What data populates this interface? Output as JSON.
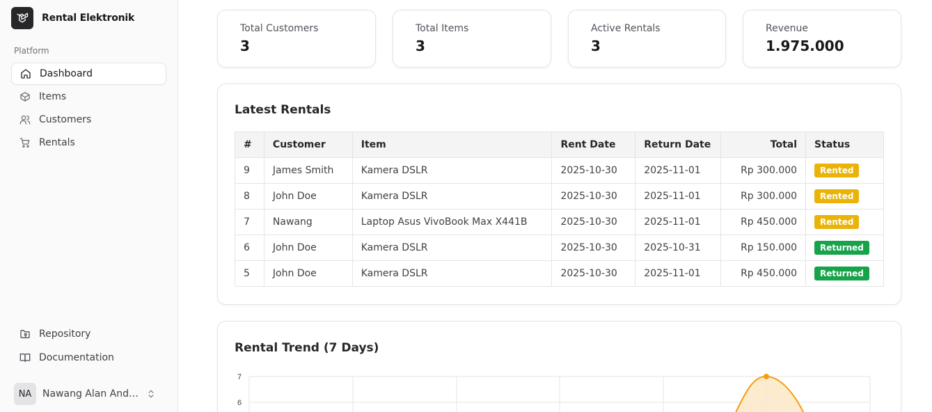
{
  "app": {
    "name": "Rental Elektronik"
  },
  "sidebar": {
    "group_label": "Platform",
    "items": [
      {
        "label": "Dashboard",
        "icon": "home-icon",
        "active": true
      },
      {
        "label": "Items",
        "icon": "box-icon",
        "active": false
      },
      {
        "label": "Customers",
        "icon": "users-icon",
        "active": false
      },
      {
        "label": "Rentals",
        "icon": "cart-icon",
        "active": false
      }
    ],
    "bottom_items": [
      {
        "label": "Repository",
        "icon": "folder-git-icon"
      },
      {
        "label": "Documentation",
        "icon": "book-open-icon"
      }
    ],
    "user": {
      "initials": "NA",
      "name": "Nawang Alan Andri..."
    }
  },
  "stats": [
    {
      "label": "Total Customers",
      "value": "3"
    },
    {
      "label": "Total Items",
      "value": "3"
    },
    {
      "label": "Active Rentals",
      "value": "3"
    },
    {
      "label": "Revenue",
      "value": "1.975.000"
    }
  ],
  "latest_rentals": {
    "title": "Latest Rentals",
    "columns": [
      "#",
      "Customer",
      "Item",
      "Rent Date",
      "Return Date",
      "Total",
      "Status"
    ],
    "rows": [
      {
        "id": "9",
        "customer": "James Smith",
        "item": "Kamera DSLR",
        "rent_date": "2025-10-30",
        "return_date": "2025-11-01",
        "total": "Rp 300.000",
        "status": "Rented"
      },
      {
        "id": "8",
        "customer": "John Doe",
        "item": "Kamera DSLR",
        "rent_date": "2025-10-30",
        "return_date": "2025-11-01",
        "total": "Rp 300.000",
        "status": "Rented"
      },
      {
        "id": "7",
        "customer": "Nawang",
        "item": "Laptop Asus VivoBook Max X441B",
        "rent_date": "2025-10-30",
        "return_date": "2025-11-01",
        "total": "Rp 450.000",
        "status": "Rented"
      },
      {
        "id": "6",
        "customer": "John Doe",
        "item": "Kamera DSLR",
        "rent_date": "2025-10-30",
        "return_date": "2025-10-31",
        "total": "Rp 150.000",
        "status": "Returned"
      },
      {
        "id": "5",
        "customer": "John Doe",
        "item": "Kamera DSLR",
        "rent_date": "2025-10-30",
        "return_date": "2025-11-01",
        "total": "Rp 450.000",
        "status": "Returned"
      }
    ]
  },
  "trend": {
    "title": "Rental Trend (7 Days)",
    "line_color": "#f59e0b",
    "fill_color": "#fde7c8",
    "y_ticks": [
      "7",
      "6"
    ],
    "peak_value": 7
  },
  "colors": {
    "rented": "#eab308",
    "returned": "#16a34a",
    "accent": "#f59e0b"
  }
}
